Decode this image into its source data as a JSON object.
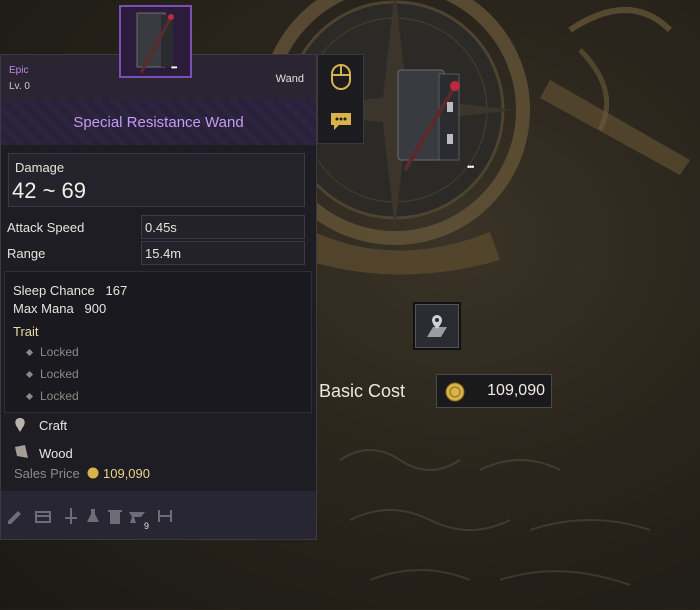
{
  "item": {
    "rarity": "Epic",
    "level": "Lv. 0",
    "type": "Wand",
    "name": "Special Resistance Wand",
    "damage_label": "Damage",
    "damage_value": "42 ~ 69",
    "stats": [
      {
        "label": "Attack Speed",
        "value": "0.45s"
      },
      {
        "label": "Range",
        "value": "15.4m"
      }
    ],
    "bonuses": [
      {
        "label": "Sleep Chance",
        "value": "167"
      },
      {
        "label": "Max Mana",
        "value": "900"
      }
    ],
    "trait_label": "Trait",
    "traits": [
      "Locked",
      "Locked",
      "Locked"
    ],
    "craft_label": "Craft",
    "material_label": "Wood",
    "sales_price_label": "Sales Price",
    "sales_price": "109,090",
    "footer_badge": "9",
    "more_dots": "•••"
  },
  "market": {
    "basic_cost_label": "Basic Cost",
    "basic_cost_value": "109,090"
  },
  "icons": [
    "mouse-icon",
    "chat-icon",
    "location-icon",
    "coin-icon",
    "craft-icon",
    "wood-icon",
    "pencil-icon",
    "chest-icon",
    "sword-icon",
    "potion-icon",
    "trash-icon",
    "anvil-icon",
    "tool-icon"
  ],
  "colors": {
    "epic": "#c59cf3",
    "coin": "#d9b24a"
  }
}
